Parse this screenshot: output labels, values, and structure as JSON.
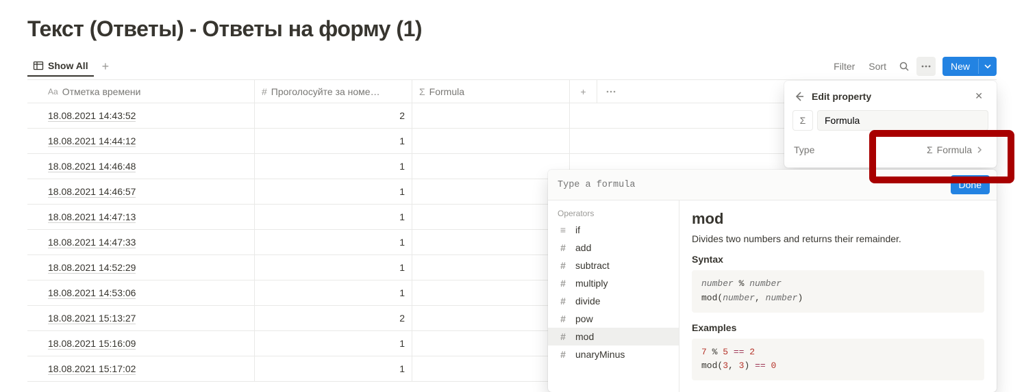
{
  "page": {
    "title": "Текст (Ответы) - Ответы на форму (1)"
  },
  "viewbar": {
    "tab_label": "Show All",
    "filter": "Filter",
    "sort": "Sort",
    "new": "New"
  },
  "table": {
    "columns": [
      "Отметка времени",
      "Проголосуйте за номе…",
      "Formula"
    ],
    "rows": [
      {
        "time": "18.08.2021 14:43:52",
        "vote": "2"
      },
      {
        "time": "18.08.2021 14:44:12",
        "vote": "1"
      },
      {
        "time": "18.08.2021 14:46:48",
        "vote": "1"
      },
      {
        "time": "18.08.2021 14:46:57",
        "vote": "1"
      },
      {
        "time": "18.08.2021 14:47:13",
        "vote": "1"
      },
      {
        "time": "18.08.2021 14:47:33",
        "vote": "1"
      },
      {
        "time": "18.08.2021 14:52:29",
        "vote": "1"
      },
      {
        "time": "18.08.2021 14:53:06",
        "vote": "1"
      },
      {
        "time": "18.08.2021 15:13:27",
        "vote": "2"
      },
      {
        "time": "18.08.2021 15:16:09",
        "vote": "1"
      },
      {
        "time": "18.08.2021 15:17:02",
        "vote": "1"
      }
    ]
  },
  "panel": {
    "title": "Edit property",
    "name_value": "Formula",
    "type_label": "Type",
    "type_value": "Formula"
  },
  "formula": {
    "placeholder": "Type a formula",
    "done": "Done",
    "section": "Operators",
    "items": [
      {
        "icon": "≡",
        "label": "if"
      },
      {
        "icon": "#",
        "label": "add"
      },
      {
        "icon": "#",
        "label": "subtract"
      },
      {
        "icon": "#",
        "label": "multiply"
      },
      {
        "icon": "#",
        "label": "divide"
      },
      {
        "icon": "#",
        "label": "pow"
      },
      {
        "icon": "#",
        "label": "mod",
        "selected": true
      },
      {
        "icon": "#",
        "label": "unaryMinus"
      }
    ],
    "doc": {
      "name": "mod",
      "desc": "Divides two numbers and returns their remainder.",
      "syntax_label": "Syntax",
      "examples_label": "Examples"
    }
  }
}
